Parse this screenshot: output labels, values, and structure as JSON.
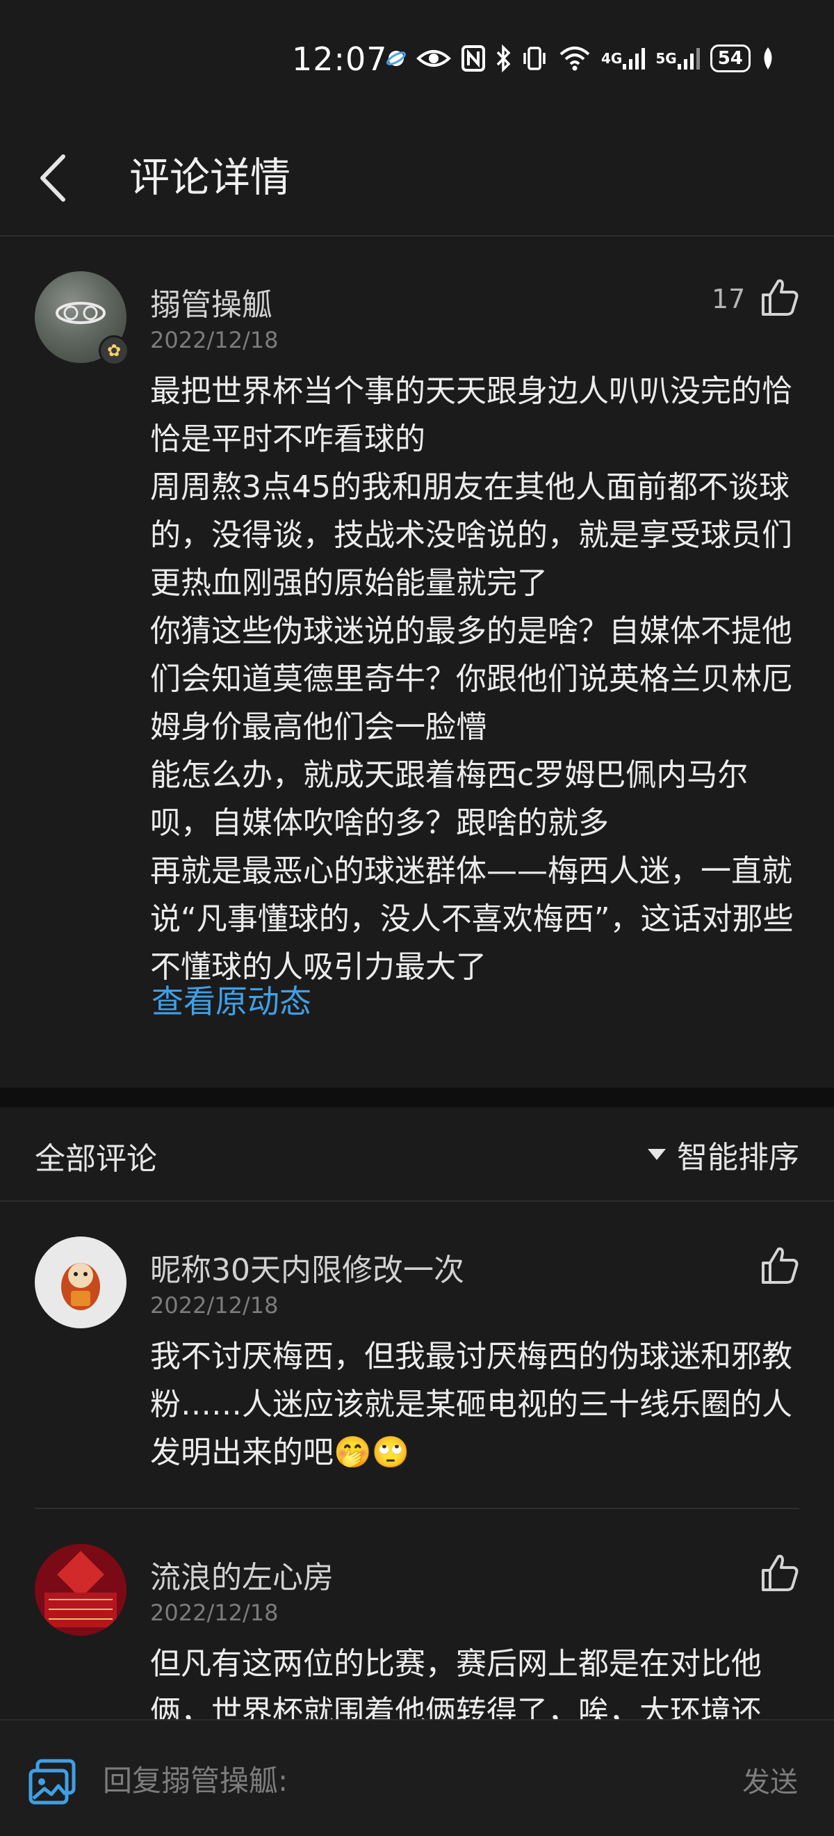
{
  "status_bar": {
    "time": "12:07",
    "battery": "54",
    "network_4g": "4G",
    "network_5g": "5G"
  },
  "header": {
    "title": "评论详情"
  },
  "main_comment": {
    "username": "搦管操觚",
    "date": "2022/12/18",
    "likes": "17",
    "paragraphs": [
      "最把世界杯当个事的天天跟身边人叭叭没完的恰恰是平时不咋看球的",
      "周周熬3点45的我和朋友在其他人面前都不谈球的，没得谈，技战术没啥说的，就是享受球员们更热血刚强的原始能量就完了",
      "你猜这些伪球迷说的最多的是啥？自媒体不提他们会知道莫德里奇牛？你跟他们说英格兰贝林厄姆身价最高他们会一脸懵",
      "能怎么办，就成天跟着梅西c罗姆巴佩内马尔呗，自媒体吹啥的多？跟啥的就多",
      "再就是最恶心的球迷群体——梅西人迷，一直就说“凡事懂球的，没人不喜欢梅西”，这话对那些不懂球的人吸引力最大了"
    ],
    "view_original": "查看原动态"
  },
  "all_comments": {
    "title": "全部评论",
    "sort_label": "智能排序",
    "replies": [
      {
        "username": "昵称30天内限修改一次",
        "date": "2022/12/18",
        "text": "我不讨厌梅西，但我最讨厌梅西的伪球迷和邪教粉……人迷应该就是某砸电视的三十线乐圈的人发明出来的吧🤭🙄"
      },
      {
        "username": "流浪的左心房",
        "date": "2022/12/18",
        "text": "但凡有这两位的比赛，赛后网上都是在对比他俩，世界杯就围着他俩转得了，唉，大环境还"
      }
    ]
  },
  "bottom_bar": {
    "reply_placeholder": "回复搦管操觚:",
    "send_label": "发送"
  },
  "colors": {
    "background": "#1b1b1b",
    "link": "#3fa0e6",
    "text": "#ececec",
    "muted": "#7c7c7c"
  }
}
